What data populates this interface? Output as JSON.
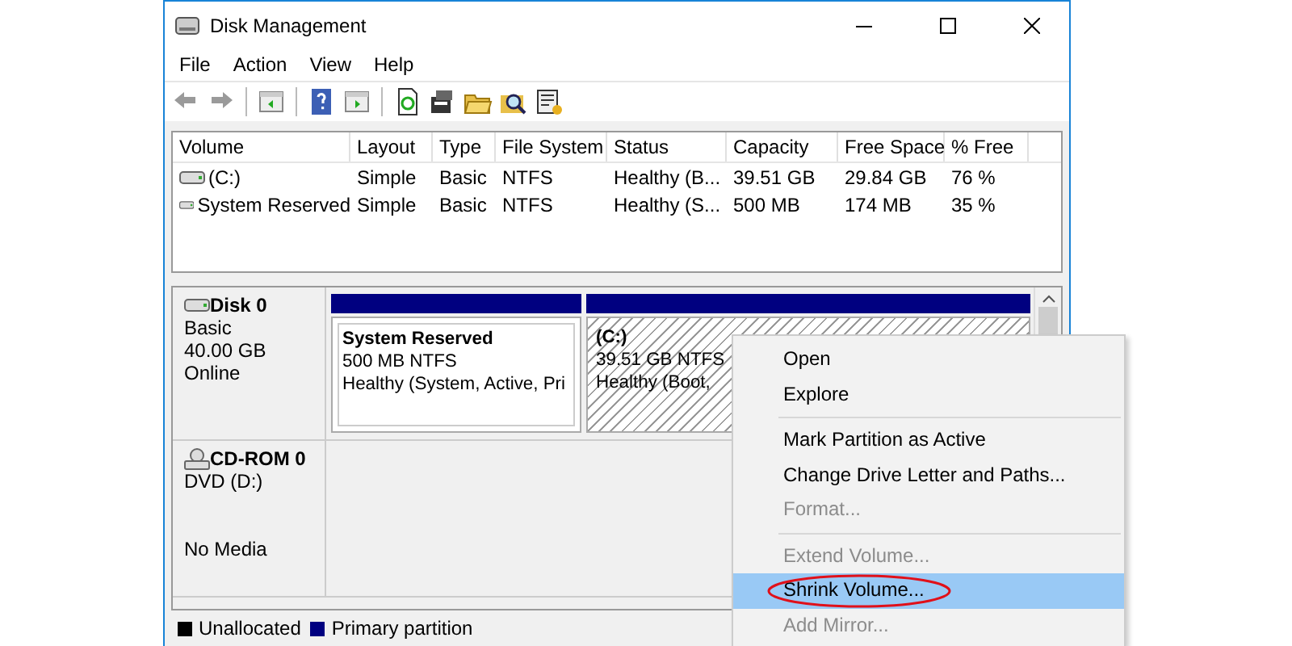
{
  "window": {
    "title": "Disk Management"
  },
  "menu_bar": [
    "File",
    "Action",
    "View",
    "Help"
  ],
  "volume_list": {
    "columns": [
      "Volume",
      "Layout",
      "Type",
      "File System",
      "Status",
      "Capacity",
      "Free Space",
      "% Free"
    ],
    "rows": [
      {
        "cells": [
          "(C:)",
          "Simple",
          "Basic",
          "NTFS",
          "Healthy (B...",
          "39.51 GB",
          "29.84 GB",
          "76 %"
        ]
      },
      {
        "cells": [
          "System Reserved",
          "Simple",
          "Basic",
          "NTFS",
          "Healthy (S...",
          "500 MB",
          "174 MB",
          "35 %"
        ]
      }
    ]
  },
  "disks": [
    {
      "kind": "disk",
      "name": "Disk 0",
      "type": "Basic",
      "size": "40.00 GB",
      "status": "Online",
      "partitions": [
        {
          "name": "System Reserved",
          "size": "500 MB NTFS",
          "status": "Healthy (System, Active, Pri",
          "selected": false
        },
        {
          "name": "(C:)",
          "size": "39.51 GB NTFS",
          "status": "Healthy (Boot,",
          "selected": true
        }
      ]
    },
    {
      "kind": "cdrom",
      "name": "CD-ROM 0",
      "type": "DVD (D:)",
      "status": "No Media"
    }
  ],
  "legend": [
    {
      "label": "Unallocated",
      "color": "#000000"
    },
    {
      "label": "Primary partition",
      "color": "#000080"
    }
  ],
  "context_menu": [
    {
      "kind": "item",
      "label": "Open",
      "disabled": false,
      "selected": false
    },
    {
      "kind": "item",
      "label": "Explore",
      "disabled": false,
      "selected": false
    },
    {
      "kind": "separator"
    },
    {
      "kind": "item",
      "label": "Mark Partition as Active",
      "disabled": false,
      "selected": false
    },
    {
      "kind": "item",
      "label": "Change Drive Letter and Paths...",
      "disabled": false,
      "selected": false
    },
    {
      "kind": "item",
      "label": "Format...",
      "disabled": true,
      "selected": false
    },
    {
      "kind": "separator"
    },
    {
      "kind": "item",
      "label": "Extend Volume...",
      "disabled": true,
      "selected": false
    },
    {
      "kind": "item",
      "label": "Shrink Volume...",
      "disabled": false,
      "selected": true,
      "circled": true
    },
    {
      "kind": "item",
      "label": "Add Mirror...",
      "disabled": true,
      "selected": false
    }
  ]
}
